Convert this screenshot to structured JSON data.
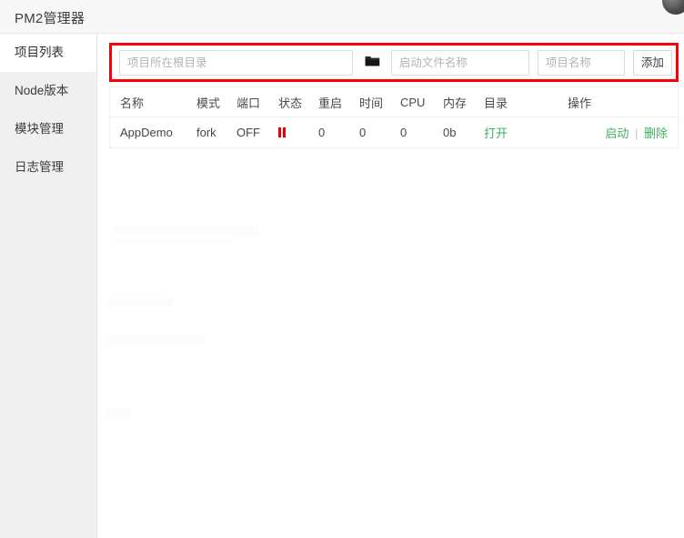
{
  "header": {
    "title": "PM2管理器",
    "avatar": "user-avatar"
  },
  "sidebar": {
    "items": [
      {
        "label": "项目列表",
        "active": true
      },
      {
        "label": "Node版本",
        "active": false
      },
      {
        "label": "模块管理",
        "active": false
      },
      {
        "label": "日志管理",
        "active": false
      }
    ]
  },
  "toolbar": {
    "highlighted": true,
    "highlight_color": "#fb0007",
    "root_dir_input": {
      "value": "",
      "placeholder": "项目所在根目录"
    },
    "browse_icon": "folder-icon",
    "entry_file_input": {
      "value": "",
      "placeholder": "启动文件名称"
    },
    "project_name_input": {
      "value": "",
      "placeholder": "项目名称"
    },
    "add_label": "添加"
  },
  "table": {
    "columns": [
      "名称",
      "模式",
      "端口",
      "状态",
      "重启",
      "时间",
      "CPU",
      "内存",
      "目录",
      "操作"
    ],
    "rows": [
      {
        "name": "AppDemo",
        "mode": "fork",
        "port": "OFF",
        "state_icon": "pause-icon",
        "state_color": "#e60000",
        "restart": "0",
        "time": "0",
        "cpu": "0",
        "memory": "0b",
        "dir_label": "打开",
        "ops": {
          "start_label": "启动",
          "separator": "|",
          "delete_label": "删除",
          "color": "#3fae5f"
        }
      }
    ]
  }
}
